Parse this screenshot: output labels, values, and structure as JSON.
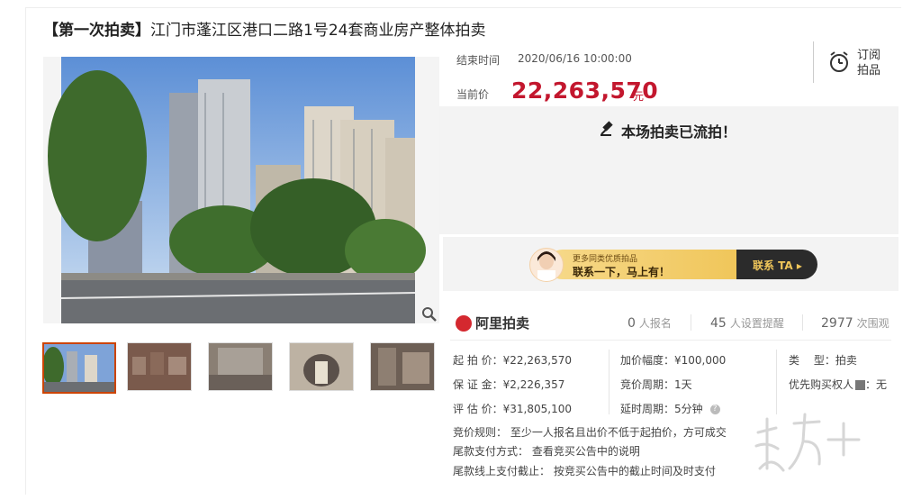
{
  "title": {
    "lot_tag": "【第一次拍卖】",
    "text": "江门市蓬江区港口二路1号24套商业房产整体拍卖"
  },
  "auction": {
    "end_label": "结束时间",
    "end_time": "2020/06/16 10:00:00",
    "price_label": "当前价",
    "current_price": "22,263,570",
    "currency": "元",
    "subscribe_label_1": "订阅",
    "subscribe_label_2": "拍品",
    "status_text": "本场拍卖已流拍！"
  },
  "promo": {
    "line1": "更多同类优质拍品",
    "line2": "联系一下，马上有！",
    "cta": "联系 TA ▸"
  },
  "platform": {
    "name": "阿里拍卖"
  },
  "stats": [
    {
      "value": "0",
      "label": "人报名"
    },
    {
      "value": "45",
      "label": "人设置提醒"
    },
    {
      "value": "2977",
      "label": "次围观"
    }
  ],
  "details": {
    "start_price": "起 拍 价：¥22,263,570",
    "deposit": "保 证 金：¥2,226,357",
    "appraisal": "评 估 价：¥31,805,100",
    "increment": "加价幅度：¥100,000",
    "cycle": "竞价周期：1天",
    "delay": "延时周期：5分钟",
    "type": "类　 型：拍卖",
    "priority": "优先购买权人",
    "priority_value": "：无",
    "rule": "竞价规则：  至少一人报名且出价不低于起拍价，方可成交",
    "payment_method": "尾款支付方式：  查看竞买公告中的说明",
    "payment_deadline": "尾款线上支付截止：  按竞买公告中的截止时间及时支付"
  },
  "watermark": "南方+",
  "icons": [
    "zoom-icon",
    "alarm-clock-icon",
    "gavel-icon",
    "help-icon",
    "ali-auction-logo-icon"
  ],
  "colors": {
    "price_red": "#c3172e",
    "promo_gold": "#f0c65a",
    "promo_dark": "#2b2b2b",
    "thumb_active": "#cc4400"
  }
}
